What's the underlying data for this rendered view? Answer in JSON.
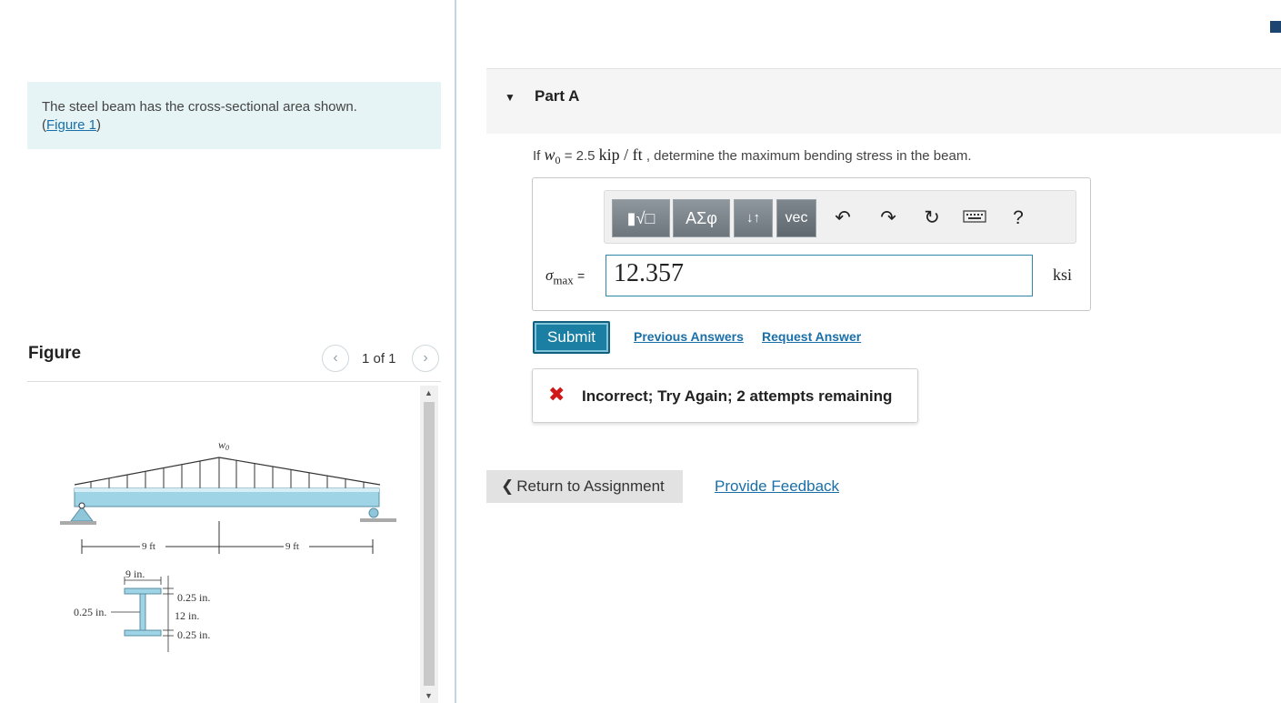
{
  "problem": {
    "text": "The steel beam has the cross-sectional area shown.",
    "figure_link_open": "(",
    "figure_link": "Figure 1",
    "figure_link_close": ")"
  },
  "figure_panel": {
    "title": "Figure",
    "pager_count": "1 of 1",
    "prev_icon": "chevron-left-icon",
    "next_icon": "chevron-right-icon",
    "diagram": {
      "load_label": "w0",
      "span_left": "9 ft",
      "span_right": "9 ft",
      "flange_width": "9 in.",
      "web_thickness": "0.25 in.",
      "top_flange": "0.25 in.",
      "depth": "12 in.",
      "bottom_flange": "0.25 in."
    }
  },
  "part": {
    "caret": "▼",
    "title": "Part A",
    "question_prefix": "If ",
    "question_var": "w",
    "question_var_sub": "0",
    "question_eq": " = 2.5 ",
    "question_unit": "kip / ft",
    "question_suffix": " , determine the maximum bending stress in the beam."
  },
  "toolbar": {
    "templates_label": "▮√□",
    "symbols_label": "ΑΣφ",
    "arrows_label": "↓↑",
    "vec_label": "vec",
    "undo_icon": "undo-icon",
    "redo_icon": "redo-icon",
    "reset_icon": "reset-icon",
    "keyboard_icon": "keyboard-icon",
    "help_label": "?"
  },
  "answer": {
    "symbol": "σ",
    "symbol_sub": "max",
    "equals": "=",
    "value": "12.357",
    "unit": "ksi"
  },
  "actions": {
    "submit_label": "Submit",
    "previous_answers_label": "Previous Answers",
    "request_answer_label": "Request Answer"
  },
  "feedback": {
    "icon": "x-icon",
    "message": "Incorrect; Try Again; 2 attempts remaining"
  },
  "footer": {
    "return_label": "Return to Assignment",
    "provide_feedback_label": "Provide Feedback"
  },
  "colors": {
    "link": "#1a6fa8",
    "submit_bg": "#1a7fa3",
    "problem_bg": "#e6f4f5",
    "error_red": "#d01818",
    "beam_blue": "#9fd3e6"
  }
}
